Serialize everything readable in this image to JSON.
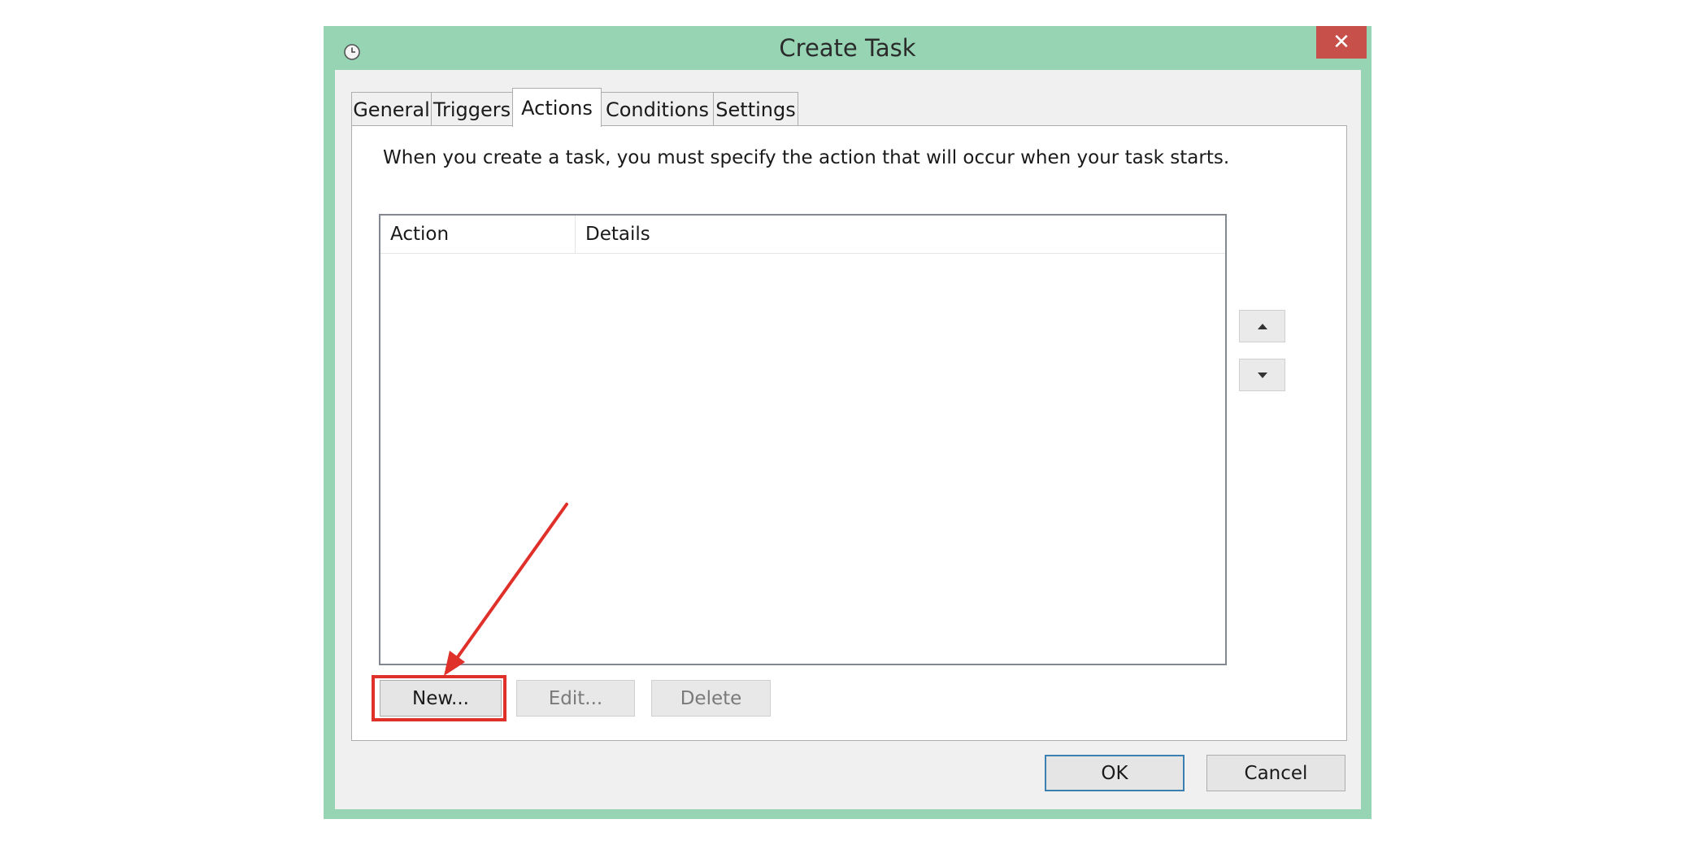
{
  "window": {
    "title": "Create Task",
    "close_label": "✕"
  },
  "tabs": [
    {
      "label": "General",
      "active": false
    },
    {
      "label": "Triggers",
      "active": false
    },
    {
      "label": "Actions",
      "active": true
    },
    {
      "label": "Conditions",
      "active": false
    },
    {
      "label": "Settings",
      "active": false
    }
  ],
  "actions_panel": {
    "instruction": "When you create a task, you must specify the action that will occur when your task starts.",
    "columns": [
      "Action",
      "Details"
    ],
    "rows": [],
    "new_label": "New...",
    "edit_label": "Edit...",
    "delete_label": "Delete"
  },
  "footer": {
    "ok_label": "OK",
    "cancel_label": "Cancel"
  },
  "colors": {
    "frame": "#96d4b4",
    "close": "#c7504a",
    "annotation": "#e0302a"
  }
}
